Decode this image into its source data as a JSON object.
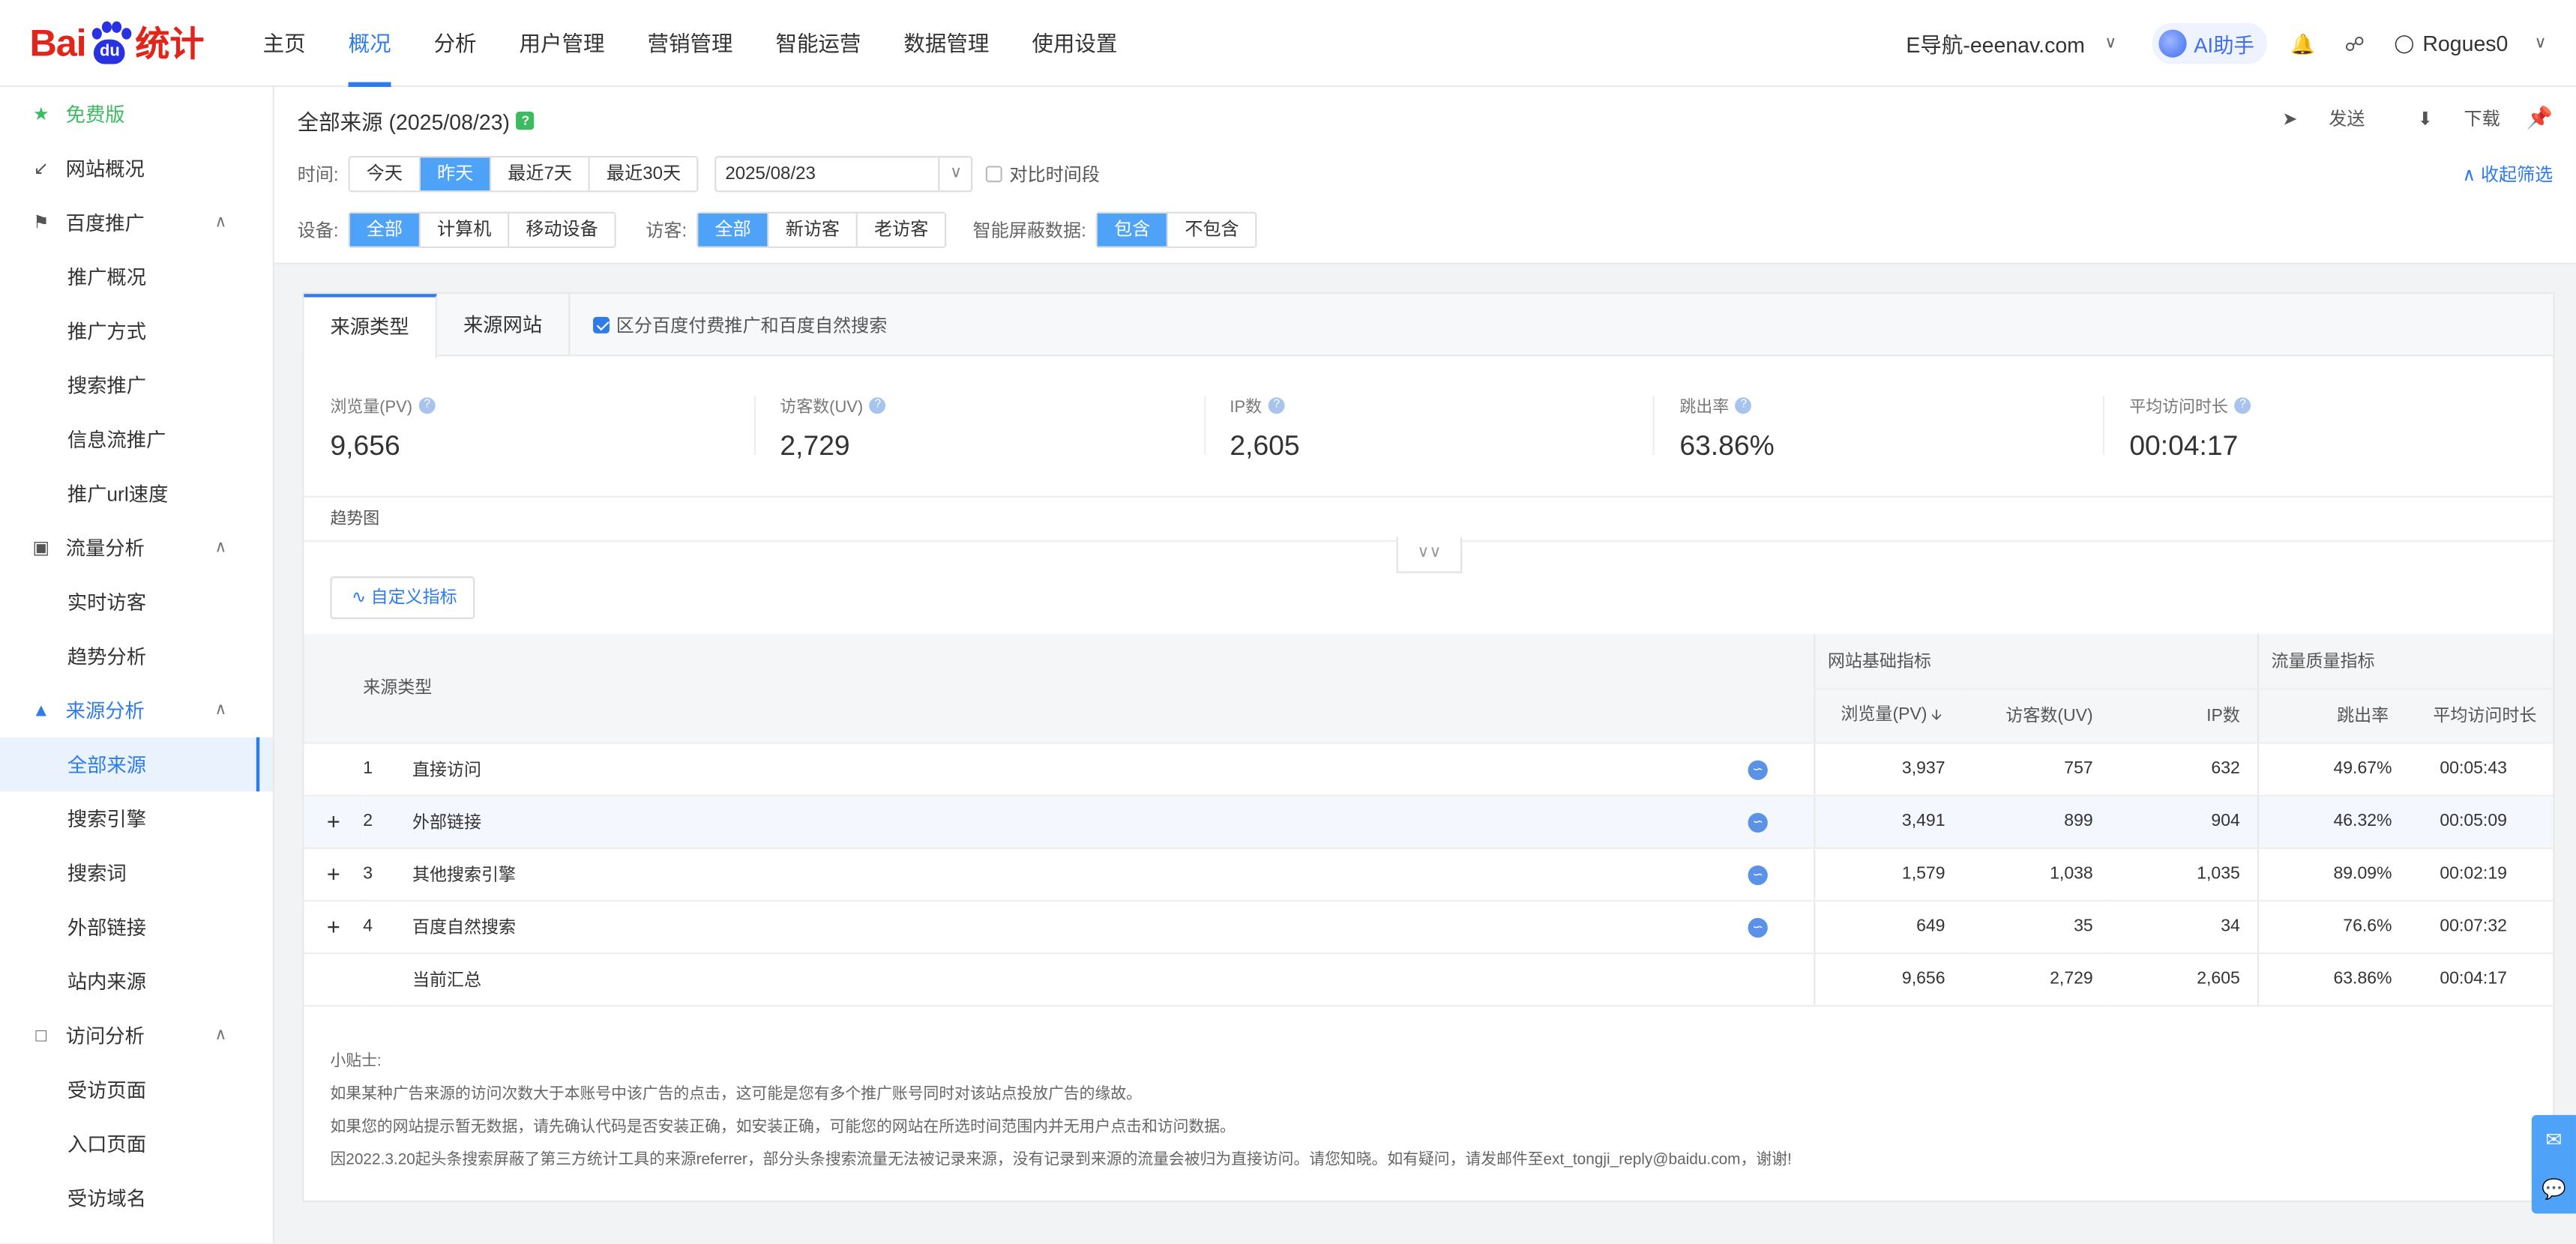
{
  "topnav": {
    "items": [
      "主页",
      "概况",
      "分析",
      "用户管理",
      "营销管理",
      "智能运营",
      "数据管理",
      "使用设置"
    ],
    "active": "概况",
    "site": "E导航-eeenav.com",
    "ai_label": "AI助手",
    "user": "Rogues0"
  },
  "sidebar": {
    "free": "免费版",
    "items": [
      {
        "label": "网站概况",
        "type": "group",
        "icon": "chart-line-icon"
      },
      {
        "label": "百度推广",
        "type": "group",
        "icon": "megaphone-icon",
        "expanded": true
      },
      {
        "label": "推广概况",
        "type": "sub"
      },
      {
        "label": "推广方式",
        "type": "sub"
      },
      {
        "label": "搜索推广",
        "type": "sub"
      },
      {
        "label": "信息流推广",
        "type": "sub"
      },
      {
        "label": "推广url速度",
        "type": "sub"
      },
      {
        "label": "流量分析",
        "type": "group",
        "icon": "traffic-icon",
        "expanded": true
      },
      {
        "label": "实时访客",
        "type": "sub"
      },
      {
        "label": "趋势分析",
        "type": "sub"
      },
      {
        "label": "来源分析",
        "type": "group",
        "icon": "source-icon",
        "expanded": true,
        "highlight": true
      },
      {
        "label": "全部来源",
        "type": "sub",
        "selected": true
      },
      {
        "label": "搜索引擎",
        "type": "sub"
      },
      {
        "label": "搜索词",
        "type": "sub"
      },
      {
        "label": "外部链接",
        "type": "sub"
      },
      {
        "label": "站内来源",
        "type": "sub"
      },
      {
        "label": "访问分析",
        "type": "group",
        "icon": "visit-icon",
        "expanded": true
      },
      {
        "label": "受访页面",
        "type": "sub"
      },
      {
        "label": "入口页面",
        "type": "sub"
      },
      {
        "label": "受访域名",
        "type": "sub"
      }
    ]
  },
  "header": {
    "title": "全部来源 (2025/08/23)",
    "send": "发送",
    "download": "下载",
    "collapse": "收起筛选"
  },
  "filters": {
    "time_label": "时间:",
    "time_options": [
      "今天",
      "昨天",
      "最近7天",
      "最近30天"
    ],
    "time_active": "昨天",
    "date": "2025/08/23",
    "compare": "对比时间段",
    "device_label": "设备:",
    "device_options": [
      "全部",
      "计算机",
      "移动设备"
    ],
    "device_active": "全部",
    "visitor_label": "访客:",
    "visitor_options": [
      "全部",
      "新访客",
      "老访客"
    ],
    "visitor_active": "全部",
    "mask_label": "智能屏蔽数据:",
    "mask_options": [
      "包含",
      "不包含"
    ],
    "mask_active": "包含"
  },
  "tabs": {
    "items": [
      "来源类型",
      "来源网站"
    ],
    "active": "来源类型",
    "checkbox": "区分百度付费推广和百度自然搜索"
  },
  "metrics": [
    {
      "label": "浏览量(PV)",
      "value": "9,656"
    },
    {
      "label": "访客数(UV)",
      "value": "2,729"
    },
    {
      "label": "IP数",
      "value": "2,605"
    },
    {
      "label": "跳出率",
      "value": "63.86%"
    },
    {
      "label": "平均访问时长",
      "value": "00:04:17"
    }
  ],
  "trend_label": "趋势图",
  "custom_metrics": "自定义指标",
  "table": {
    "source_header": "来源类型",
    "group1": "网站基础指标",
    "group2": "流量质量指标",
    "columns": [
      "浏览量(PV)",
      "访客数(UV)",
      "IP数",
      "跳出率",
      "平均访问时长"
    ],
    "rows": [
      {
        "idx": "1",
        "name": "直接访问",
        "expandable": false,
        "link": false,
        "pv": "3,937",
        "uv": "757",
        "ip": "632",
        "bounce": "49.67%",
        "dur": "00:05:43"
      },
      {
        "idx": "2",
        "name": "外部链接",
        "expandable": true,
        "link": true,
        "pv": "3,491",
        "uv": "899",
        "ip": "904",
        "bounce": "46.32%",
        "dur": "00:05:09"
      },
      {
        "idx": "3",
        "name": "其他搜索引擎",
        "expandable": true,
        "link": false,
        "pv": "1,579",
        "uv": "1,038",
        "ip": "1,035",
        "bounce": "89.09%",
        "dur": "00:02:19"
      },
      {
        "idx": "4",
        "name": "百度自然搜索",
        "expandable": true,
        "link": true,
        "pv": "649",
        "uv": "35",
        "ip": "34",
        "bounce": "76.6%",
        "dur": "00:07:32"
      }
    ],
    "total": {
      "name": "当前汇总",
      "pv": "9,656",
      "uv": "2,729",
      "ip": "2,605",
      "bounce": "63.86%",
      "dur": "00:04:17"
    }
  },
  "tips": {
    "title": "小贴士:",
    "lines": [
      "如果某种广告来源的访问次数大于本账号中该广告的点击，这可能是您有多个推广账号同时对该站点投放广告的缘故。",
      "如果您的网站提示暂无数据，请先确认代码是否安装正确，如安装正确，可能您的网站在所选时间范围内并无用户点击和访问数据。",
      "因2022.3.20起头条搜索屏蔽了第三方统计工具的来源referrer，部分头条搜索流量无法被记录来源，没有记录到来源的流量会被归为直接访问。请您知晓。如有疑问，请发邮件至ext_tongji_reply@baidu.com，谢谢!"
    ]
  }
}
